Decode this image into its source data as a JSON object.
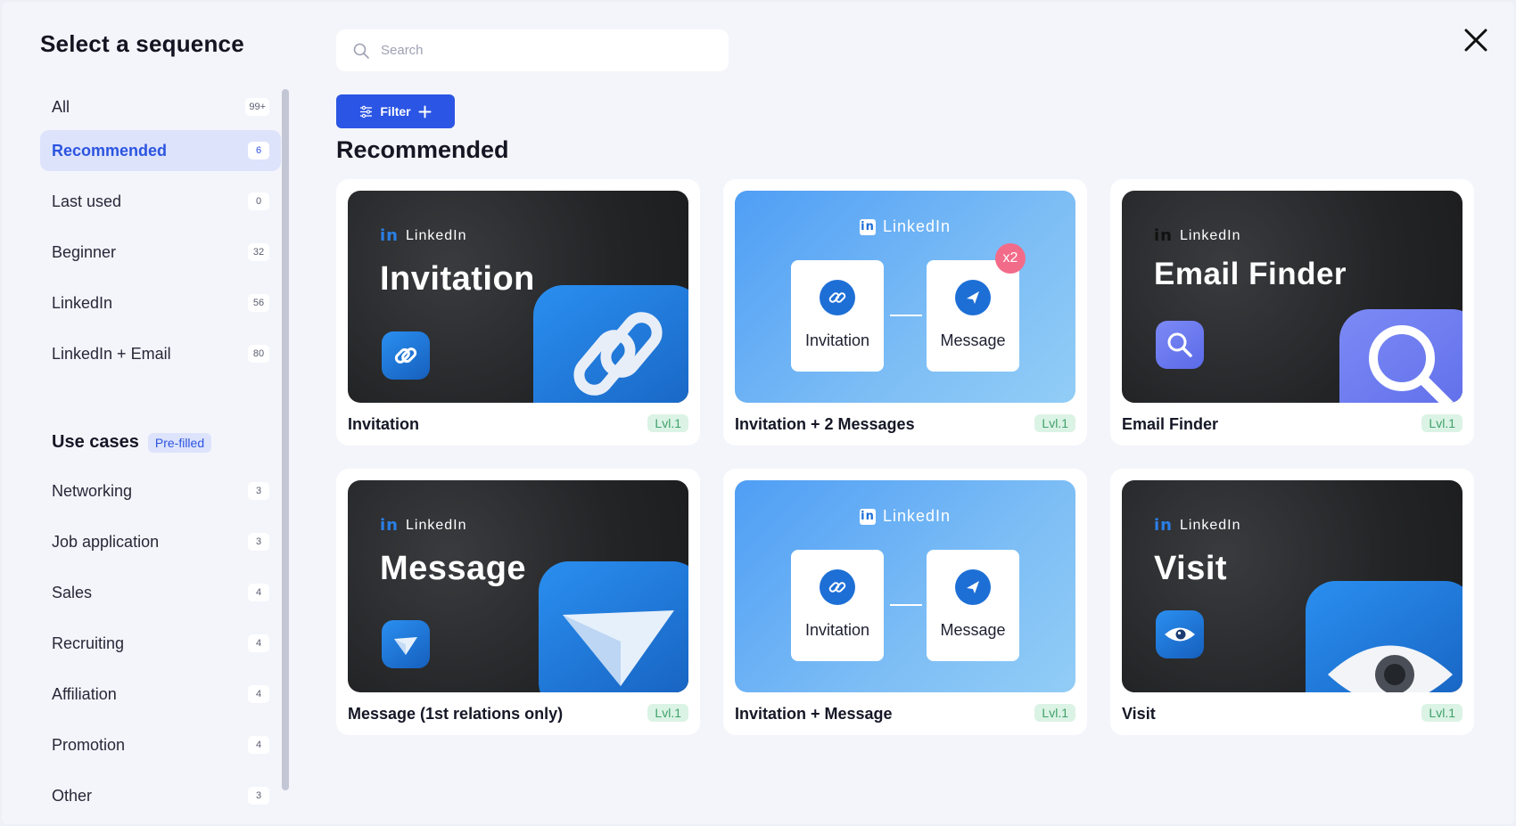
{
  "modal": {
    "title": "Select a sequence"
  },
  "search": {
    "placeholder": "Search"
  },
  "filter": {
    "label": "Filter"
  },
  "main": {
    "section_title": "Recommended"
  },
  "sidebar": {
    "items": [
      {
        "label": "All",
        "count": "99+"
      },
      {
        "label": "Recommended",
        "count": "6",
        "active": true
      },
      {
        "label": "Last used",
        "count": "0"
      },
      {
        "label": "Beginner",
        "count": "32"
      },
      {
        "label": "LinkedIn",
        "count": "56"
      },
      {
        "label": "LinkedIn + Email",
        "count": "80"
      }
    ],
    "use_cases": {
      "title": "Use cases",
      "badge": "Pre-filled",
      "items": [
        {
          "label": "Networking",
          "count": "3"
        },
        {
          "label": "Job application",
          "count": "3"
        },
        {
          "label": "Sales",
          "count": "4"
        },
        {
          "label": "Recruiting",
          "count": "4"
        },
        {
          "label": "Affiliation",
          "count": "4"
        },
        {
          "label": "Promotion",
          "count": "4"
        },
        {
          "label": "Other",
          "count": "3"
        }
      ]
    }
  },
  "cards": [
    {
      "name": "Invitation",
      "level": "Lvl.1",
      "thumb_brand": "LinkedIn",
      "thumb_title": "Invitation",
      "icon": "link-icon"
    },
    {
      "name": "Invitation + 2 Messages",
      "level": "Lvl.1",
      "thumb_brand": "LinkedIn",
      "step1": "Invitation",
      "step2": "Message",
      "multiplier": "x2"
    },
    {
      "name": "Email Finder",
      "level": "Lvl.1",
      "thumb_brand": "LinkedIn",
      "thumb_title": "Email Finder",
      "icon": "magnifier-icon"
    },
    {
      "name": "Message (1st relations only)",
      "level": "Lvl.1",
      "thumb_brand": "LinkedIn",
      "thumb_title": "Message",
      "icon": "paper-plane-icon"
    },
    {
      "name": "Invitation + Message",
      "level": "Lvl.1",
      "thumb_brand": "LinkedIn",
      "step1": "Invitation",
      "step2": "Message"
    },
    {
      "name": "Visit",
      "level": "Lvl.1",
      "thumb_brand": "LinkedIn",
      "thumb_title": "Visit",
      "icon": "eye-icon"
    }
  ],
  "colors": {
    "accent": "#2b55e4",
    "active_bg": "#dde3fb",
    "level_green": "#3fa06a",
    "linkedin_blue": "#1d6fd6"
  }
}
